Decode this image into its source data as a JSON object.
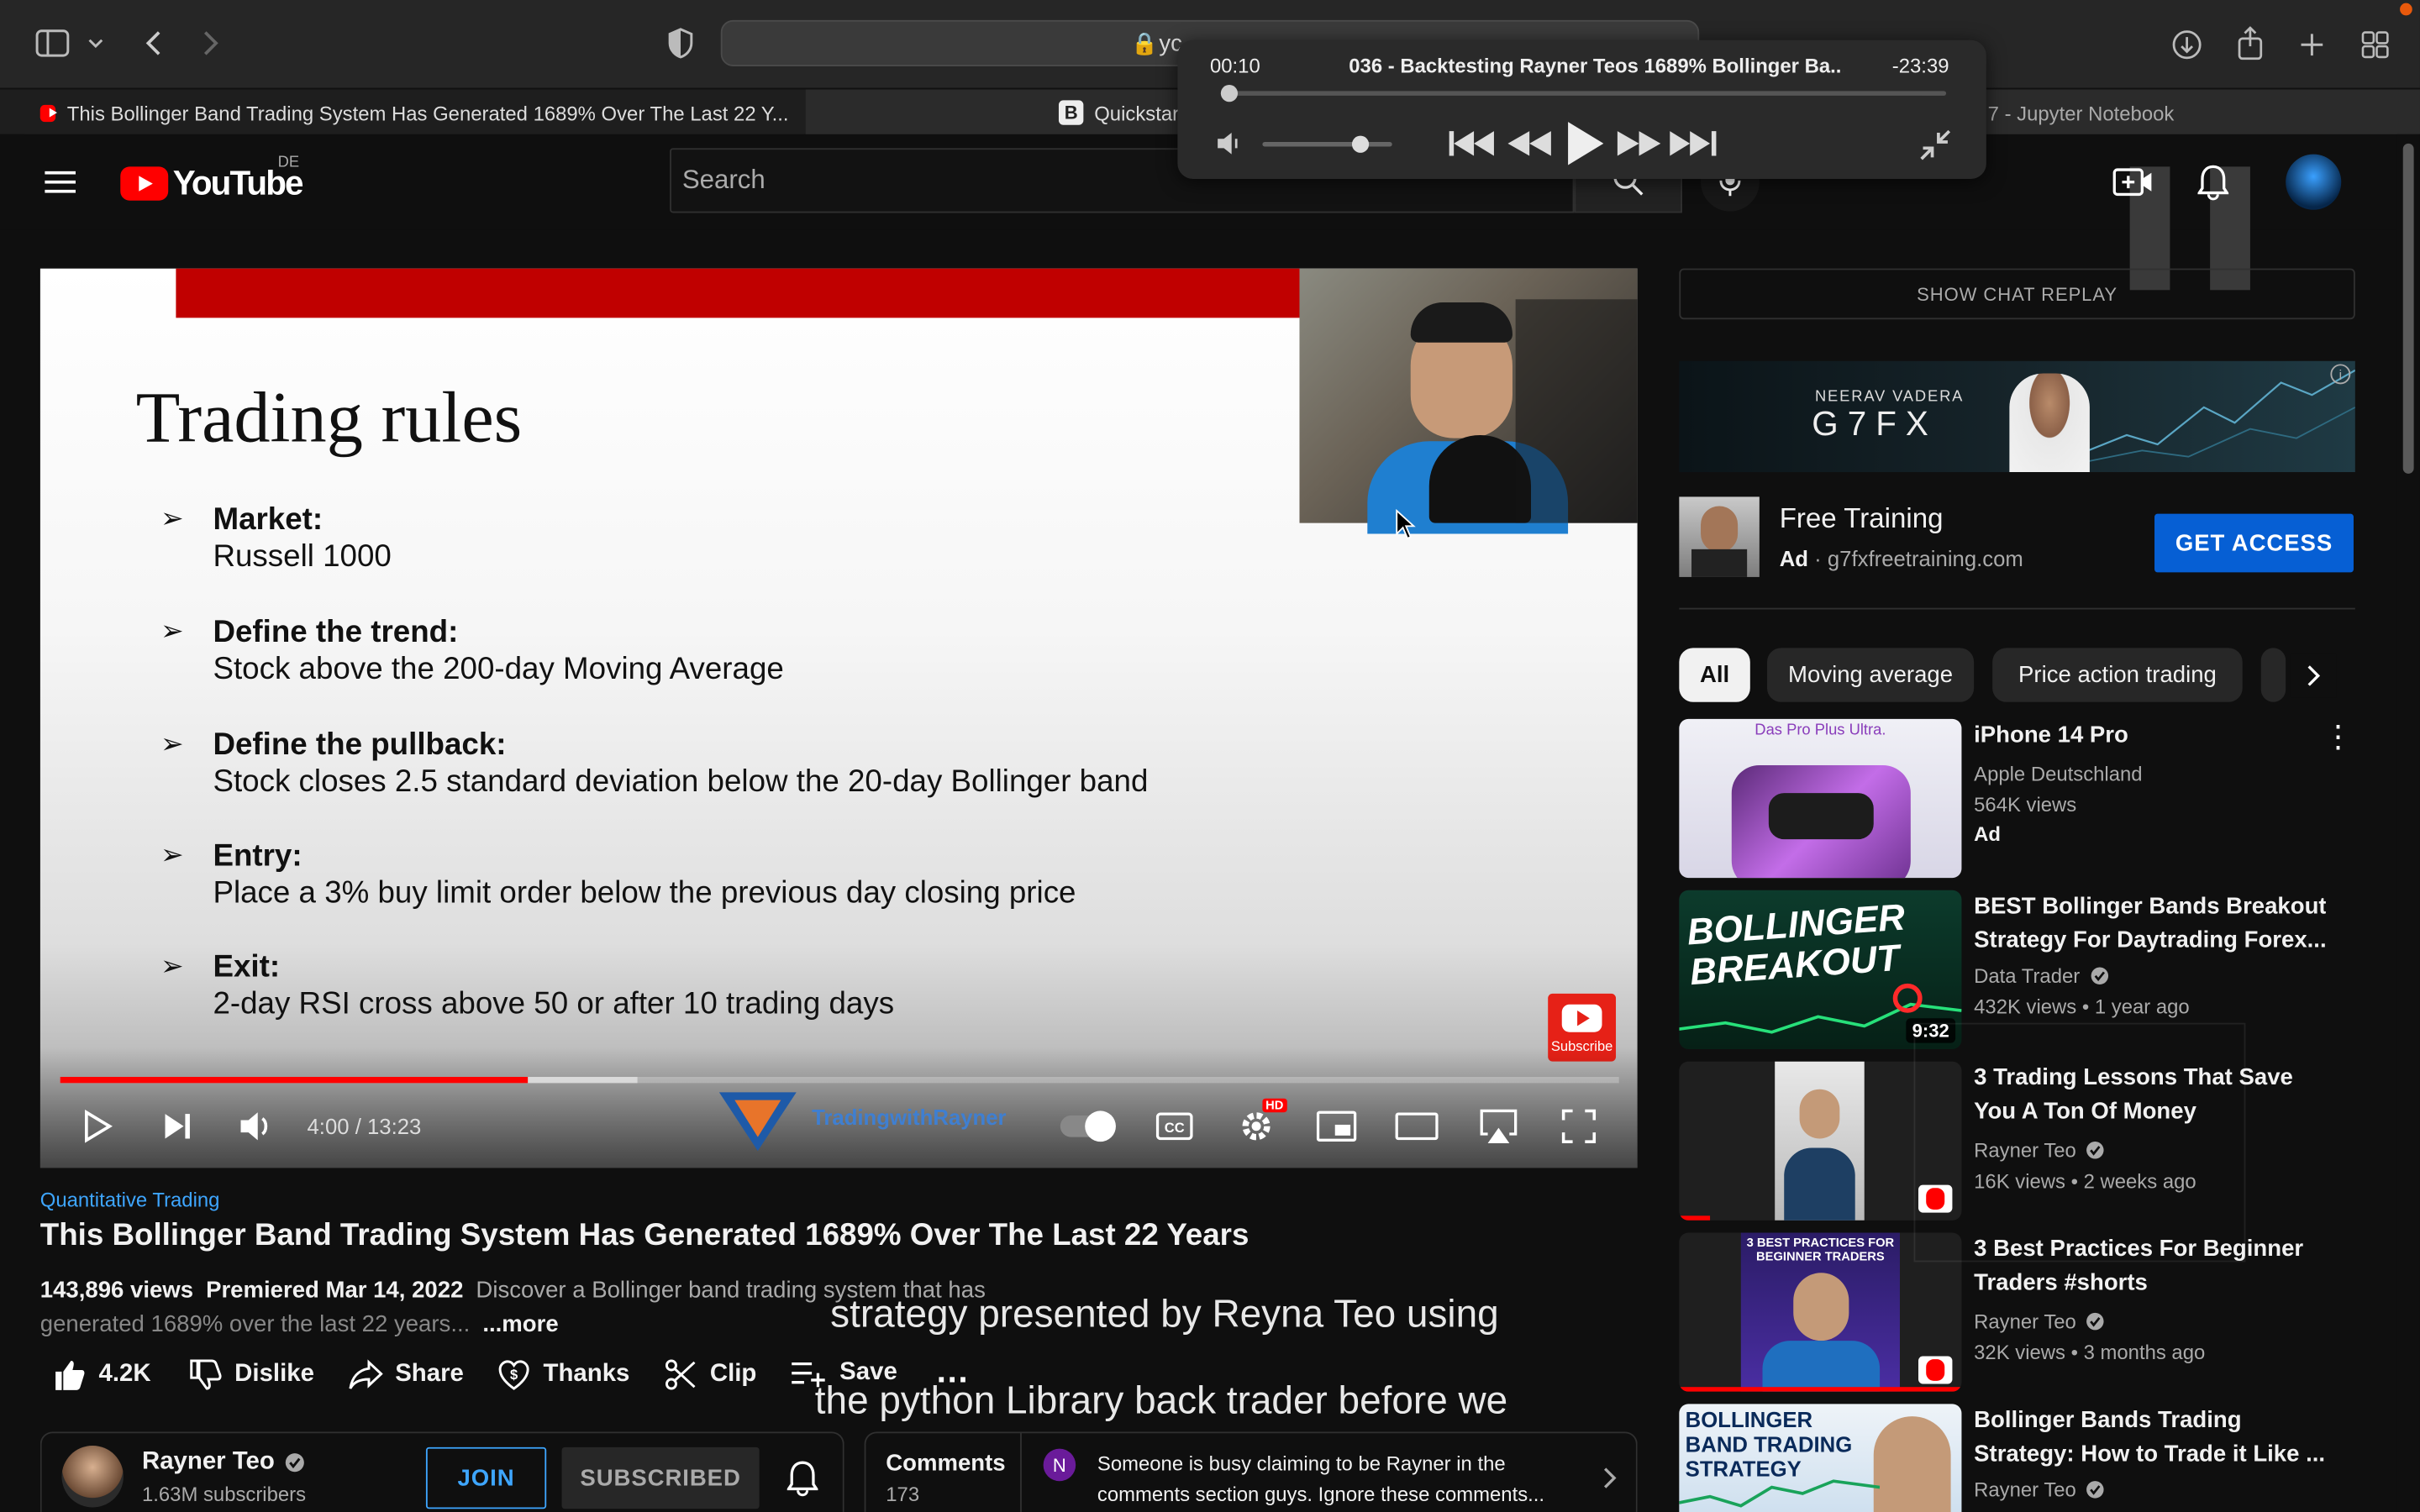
{
  "browser": {
    "url_fragment": "yc",
    "tabs": [
      {
        "label": "This Bollinger Band Trading System Has Generated 1689% Over The Last 22 Y..."
      },
      {
        "label": "Quickstar"
      },
      {
        "label": "7 - Jupyter Notebook"
      }
    ]
  },
  "mini_player": {
    "elapsed": "00:10",
    "title": "036 - Backtesting Rayner Teos 1689% Bollinger Ba...",
    "remaining": "-23:39",
    "progress_fraction": 0.01,
    "volume_fraction": 0.75
  },
  "youtube": {
    "logo_text": "YouTube",
    "region": "DE",
    "search_placeholder": "Search"
  },
  "slide": {
    "title": "Trading rules",
    "rules": [
      {
        "heading": "Market:",
        "body": "Russell 1000"
      },
      {
        "heading": "Define the trend:",
        "body": "Stock above the 200-day Moving Average"
      },
      {
        "heading": "Define the pullback:",
        "body": "Stock closes 2.5 standard deviation below the 20-day Bollinger band"
      },
      {
        "heading": "Entry:",
        "body": "Place a 3% buy limit order below the previous day closing price"
      },
      {
        "heading": "Exit:",
        "body": "2-day RSI cross above 50 or after 10 trading days"
      }
    ],
    "subscribe_label": "Subscribe",
    "watermark": "TradingwithRayner"
  },
  "player": {
    "time": "4:00 / 13:23",
    "played_fraction": 0.3,
    "buffered_fraction": 0.37,
    "hd_badge": "HD"
  },
  "video": {
    "hashtag": "Quantitative Trading",
    "title": "This Bollinger Band Trading System Has Generated 1689% Over The Last 22 Years",
    "views": "143,896 views",
    "premiered": "Premiered Mar 14, 2022",
    "desc_line1": "Discover a Bollinger band trading system that has",
    "desc_line2": "generated 1689% over the last 22 years...",
    "more": "...more",
    "likes": "4.2K",
    "dislike": "Dislike",
    "share": "Share",
    "thanks": "Thanks",
    "clip": "Clip",
    "save": "Save"
  },
  "channel": {
    "name": "Rayner Teo",
    "subscribers": "1.63M subscribers",
    "join": "JOIN",
    "subscribed": "SUBSCRIBED"
  },
  "comments": {
    "label": "Comments",
    "count": "173",
    "avatar_letter": "N",
    "preview_line1": "Someone is busy claiming to be Rayner in the",
    "preview_line2": "comments section guys. Ignore these comments..."
  },
  "captions": {
    "line1": "strategy presented by Reyna Teo using",
    "line2": "the python Library back trader before we"
  },
  "sidebar": {
    "show_chat": "SHOW CHAT REPLAY",
    "ad_banner_brand": "NEERAV VADERA",
    "ad_banner_logo": "G7FX",
    "ad_title": "Free Training",
    "ad_badge": "Ad",
    "ad_domain": "g7fxfreetraining.com",
    "ad_cta": "GET ACCESS",
    "chips": [
      "All",
      "Moving average",
      "Price action trading"
    ],
    "videos": [
      {
        "title": "iPhone 14 Pro",
        "channel": "Apple Deutschland",
        "meta": "564K views",
        "badge": "Ad",
        "thumb_text": "Das Pro Plus Ultra."
      },
      {
        "title": "BEST Bollinger Bands Breakout",
        "title2": "Strategy For Daytrading Forex...",
        "channel": "Data Trader",
        "meta": "432K views • 1 year ago",
        "duration": "9:32",
        "thumb_text": "BOLLINGER BREAKOUT"
      },
      {
        "title": "3 Trading Lessons That Save",
        "title2": "You A Ton Of Money",
        "channel": "Rayner Teo",
        "meta": "16K views • 2 weeks ago"
      },
      {
        "title": "3 Best Practices For Beginner",
        "title2": "Traders #shorts",
        "channel": "Rayner Teo",
        "meta": "32K views • 3 months ago",
        "thumb_text": "3 BEST PRACTICES FOR BEGINNER TRADERS"
      },
      {
        "title": "Bollinger Bands Trading",
        "title2": "Strategy: How to Trade it Like ...",
        "channel": "Rayner Teo",
        "thumb_text": "BOLLINGER BAND TRADING STRATEGY"
      }
    ]
  }
}
